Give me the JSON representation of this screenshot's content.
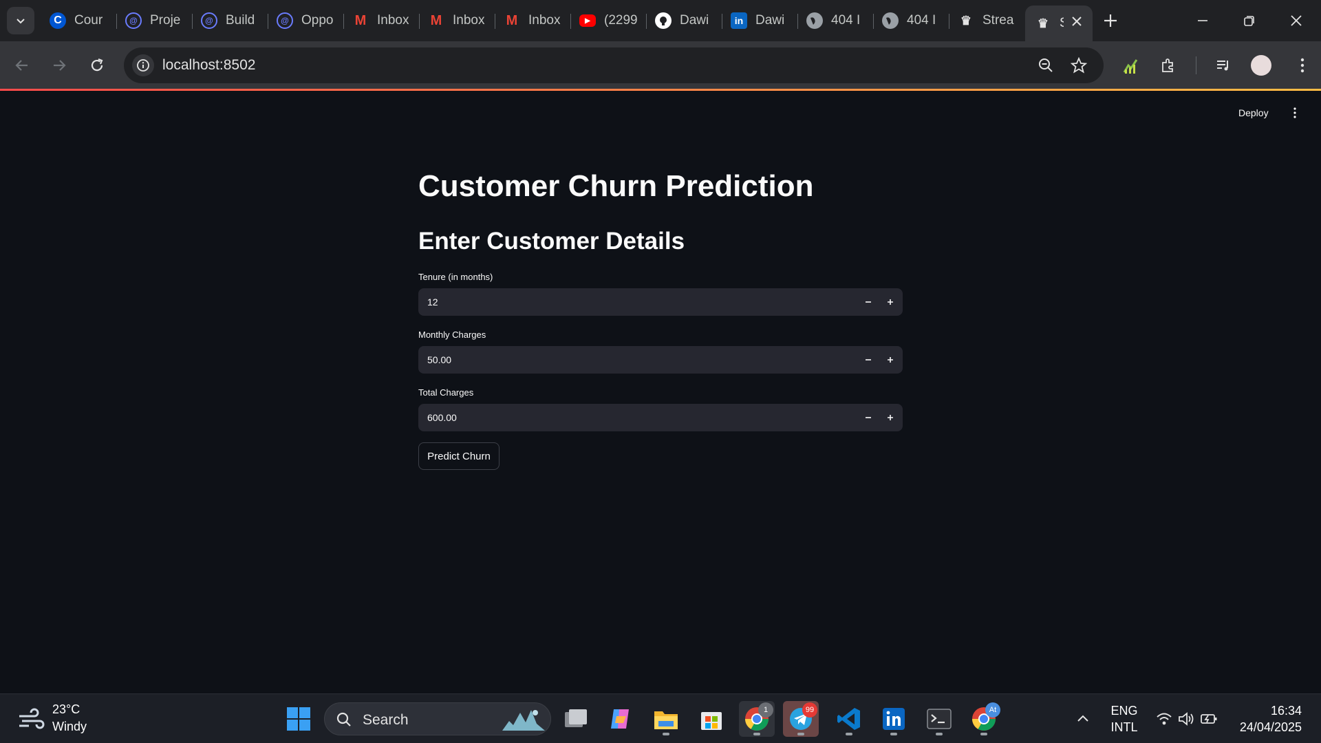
{
  "browser": {
    "tabs": [
      {
        "label": "Cour",
        "icon": "coursera-icon",
        "color": "#0056d2",
        "glyph": "C"
      },
      {
        "label": "Proje",
        "icon": "swirl-icon",
        "color": "#6a7cff",
        "glyph": "◎"
      },
      {
        "label": "Build",
        "icon": "swirl-icon",
        "color": "#6a7cff",
        "glyph": "◎"
      },
      {
        "label": "Oppo",
        "icon": "swirl-icon",
        "color": "#6a7cff",
        "glyph": "◎"
      },
      {
        "label": "Inbox",
        "icon": "gmail-icon",
        "color": "#ea4335",
        "glyph": "M"
      },
      {
        "label": "Inbox",
        "icon": "gmail-icon",
        "color": "#ea4335",
        "glyph": "M"
      },
      {
        "label": "Inbox",
        "icon": "gmail-icon",
        "color": "#ea4335",
        "glyph": "M"
      },
      {
        "label": "(2299",
        "icon": "youtube-icon",
        "color": "#ff0000",
        "glyph": "▶"
      },
      {
        "label": "Dawi",
        "icon": "github-icon",
        "color": "#ffffff",
        "glyph": "●"
      },
      {
        "label": "Dawi",
        "icon": "linkedin-icon",
        "color": "#0a66c2",
        "glyph": "in"
      },
      {
        "label": "404 I",
        "icon": "globe-icon",
        "color": "#9aa0a6",
        "glyph": "◍"
      },
      {
        "label": "404 I",
        "icon": "globe-icon",
        "color": "#9aa0a6",
        "glyph": "◍"
      },
      {
        "label": "Strea",
        "icon": "streamlit-crown-icon",
        "color": "#e3e3e3",
        "glyph": "♛"
      }
    ],
    "active_tab": {
      "label": "S",
      "icon": "streamlit-crown-icon",
      "glyph": "♛"
    },
    "url": "localhost:8502"
  },
  "app": {
    "deploy_label": "Deploy",
    "title": "Customer Churn Prediction",
    "subtitle": "Enter Customer Details",
    "fields": [
      {
        "label": "Tenure (in months)",
        "value": "12"
      },
      {
        "label": "Monthly Charges",
        "value": "50.00"
      },
      {
        "label": "Total Charges",
        "value": "600.00"
      }
    ],
    "predict_label": "Predict Churn",
    "step_minus": "−",
    "step_plus": "+"
  },
  "taskbar": {
    "weather_temp": "23°C",
    "weather_desc": "Windy",
    "search_placeholder": "Search",
    "telegram_badge": "99",
    "chrome_badge": "At",
    "lang_top": "ENG",
    "lang_bottom": "INTL",
    "time": "16:34",
    "date": "24/04/2025"
  },
  "colors": {
    "page_bg": "#0e1117",
    "input_bg": "#262730",
    "accent_gradient_start": "#ff4b4b",
    "accent_gradient_end": "#ffbd45"
  }
}
